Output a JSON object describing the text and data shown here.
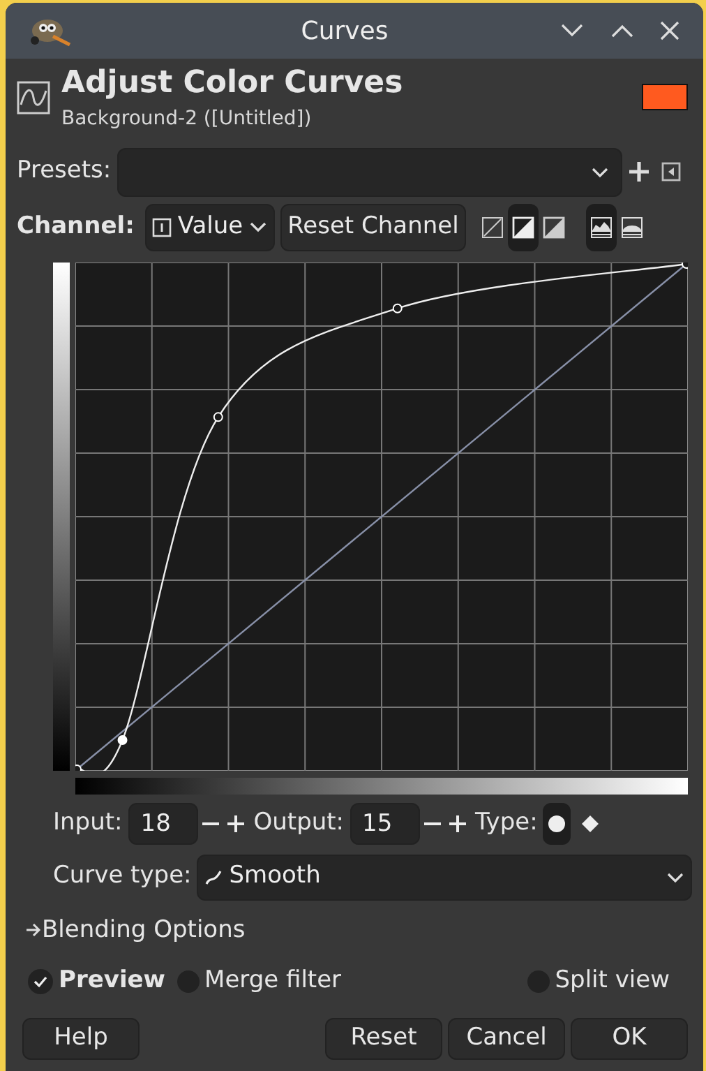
{
  "window": {
    "title": "Curves"
  },
  "header": {
    "title": "Adjust Color Curves",
    "subtitle": "Background-2 ([Untitled])"
  },
  "presets": {
    "label": "Presets:"
  },
  "channel": {
    "label": "Channel:",
    "value": "Value",
    "reset": "Reset Channel",
    "modes": [
      {
        "kind": "linear",
        "selected": false
      },
      {
        "kind": "mixed",
        "selected": true
      },
      {
        "kind": "inverse",
        "selected": false
      }
    ],
    "scales": [
      {
        "kind": "linear",
        "selected": true
      },
      {
        "kind": "log",
        "selected": false
      }
    ]
  },
  "point": {
    "input_label": "Input:",
    "input_value": "18",
    "output_label": "Output:",
    "output_value": "15",
    "type_label": "Type:",
    "types": [
      {
        "kind": "smooth",
        "selected": true
      },
      {
        "kind": "corner",
        "selected": false
      }
    ]
  },
  "curve_type": {
    "label": "Curve type:",
    "value": "Smooth"
  },
  "blending": {
    "label": "Blending Options",
    "expanded": false
  },
  "options": [
    {
      "kind": "check",
      "label": "Preview",
      "checked": true
    },
    {
      "kind": "toggle",
      "label": "Merge filter",
      "checked": false
    },
    {
      "kind": "toggle",
      "label": "Split view",
      "checked": false
    }
  ],
  "buttons": [
    {
      "label": "Help"
    },
    {
      "label": "Reset"
    },
    {
      "label": "Cancel"
    },
    {
      "label": "OK"
    }
  ]
}
